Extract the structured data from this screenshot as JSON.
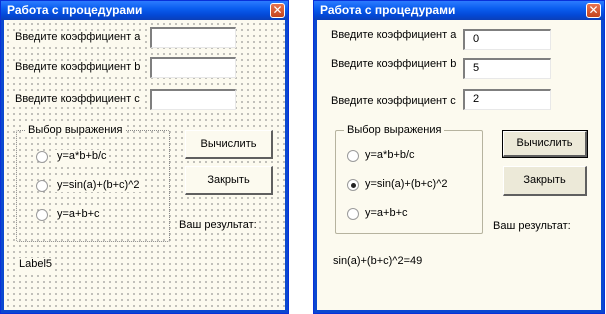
{
  "design_window": {
    "title": "Работа с процедурами",
    "label_a": "Введите коэффициент a",
    "label_b": "Введите коэффициент b",
    "label_c": "Введите коэффициент с",
    "frame_title": "Выбор выражения",
    "option1": "y=a*b+b/c",
    "option2": "y=sin(a)+(b+c)^2",
    "option3": "y=a+b+c",
    "calc_button": "Вычислить",
    "close_button": "Закрыть",
    "result_label": "Ваш результат:",
    "output_label": "Label5"
  },
  "run_window": {
    "title": "Работа с процедурами",
    "label_a": "Введите коэффициент a",
    "label_b": "Введите коэффициент b",
    "label_c": "Введите коэффициент с",
    "value_a": "0",
    "value_b": "5",
    "value_c": "2",
    "frame_title": "Выбор выражения",
    "option1": "y=a*b+b/c",
    "option2": "y=sin(a)+(b+c)^2",
    "option3": "y=a+b+c",
    "selected_option": "y=sin(a)+(b+c)^2",
    "calc_button": "Вычислить",
    "close_button": "Закрыть",
    "result_label": "Ваш результат:",
    "output_label": "sin(a)+(b+c)^2=49"
  },
  "icons": {
    "close": "close-x-icon"
  }
}
